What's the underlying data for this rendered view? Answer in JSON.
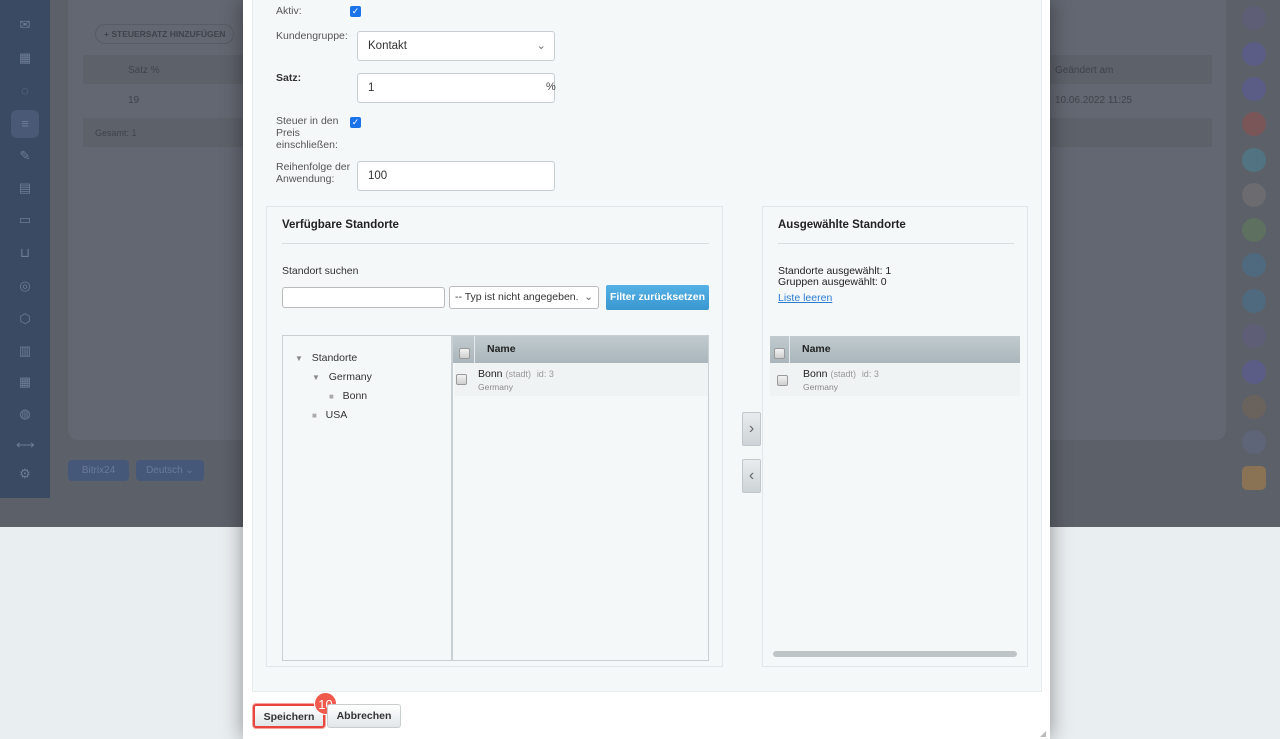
{
  "background": {
    "add_button": "STEUERSATZ HINZUFÜGEN",
    "columns": [
      "Satz %",
      "Geändert am"
    ],
    "row": {
      "rate": "19",
      "changed": "10.06.2022 11:25"
    },
    "total": "Gesamt: 1",
    "bitrix_button": "Bitrix24",
    "language_button": "Deutsch"
  },
  "form": {
    "active_label": "Aktiv:",
    "active_checked": true,
    "customer_group_label": "Kundengruppe:",
    "customer_group_value": "Kontakt",
    "rate_label": "Satz:",
    "rate_value": "1",
    "rate_unit": "%",
    "include_tax_label": "Steuer in den Preis einschließen:",
    "include_tax_checked": true,
    "order_label": "Reihenfolge der Anwendung:",
    "order_value": "100"
  },
  "available": {
    "title": "Verfügbare Standorte",
    "search_label": "Standort suchen",
    "search_value": "",
    "type_select": "-- Typ ist nicht angegeben.",
    "reset_button": "Filter zurücksetzen",
    "tree": [
      {
        "label": "Standorte",
        "level": 0,
        "type": "expanded"
      },
      {
        "label": "Germany",
        "level": 1,
        "type": "expanded"
      },
      {
        "label": "Bonn",
        "level": 2,
        "type": "leaf"
      },
      {
        "label": "USA",
        "level": 1,
        "type": "leaf"
      }
    ],
    "column": "Name",
    "rows": [
      {
        "name": "Bonn",
        "type": "(stadt)",
        "id": "id: 3",
        "parent": "Germany"
      }
    ]
  },
  "selected": {
    "title": "Ausgewählte Standorte",
    "locations_count": "Standorte ausgewählt: 1",
    "groups_count": "Gruppen ausgewählt: 0",
    "clear_link": "Liste leeren",
    "column": "Name",
    "rows": [
      {
        "name": "Bonn",
        "type": "(stadt)",
        "id": "id: 3",
        "parent": "Germany"
      }
    ]
  },
  "footer": {
    "save": "Speichern",
    "cancel": "Abbrechen",
    "step_badge": "10"
  },
  "colors": {
    "accent": "#3fa0d8",
    "highlight": "#e8453c",
    "checkbox": "#1a73e8"
  }
}
